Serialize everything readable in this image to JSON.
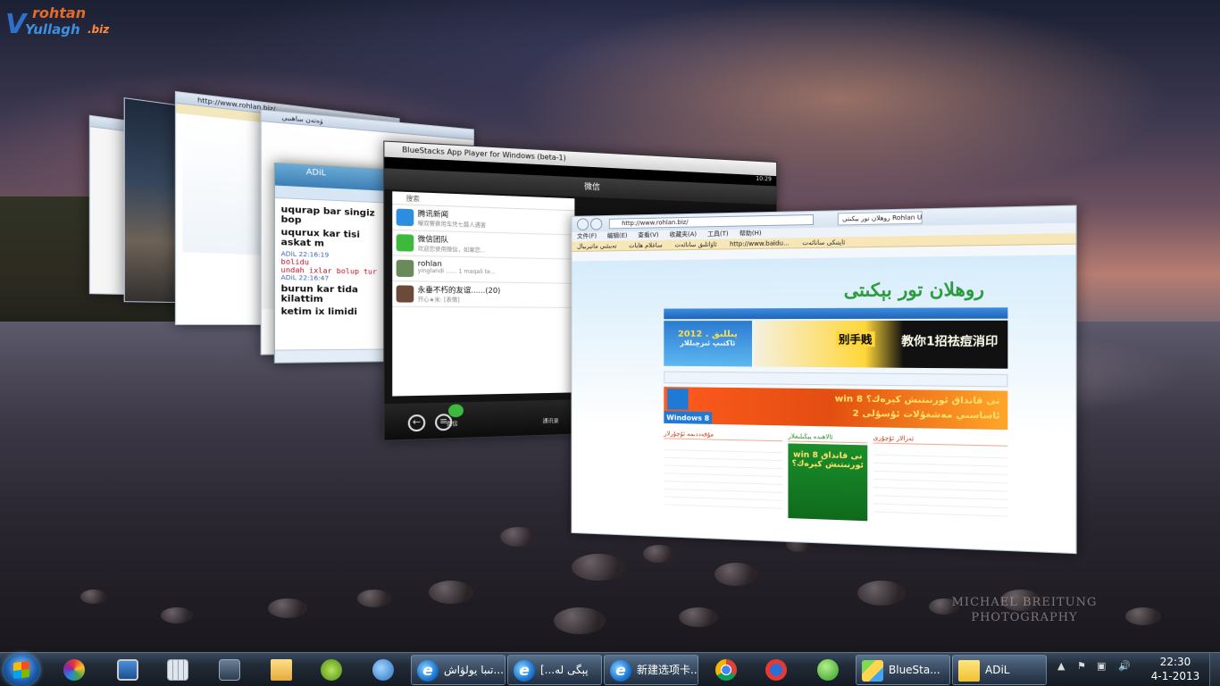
{
  "logo": {
    "top": "rohtan",
    "bottom": "Yullagh",
    "tld": ".biz"
  },
  "watermark": {
    "line1": "MICHAEL BREITUNG",
    "line2": "PHOTOGRAPHY"
  },
  "windows": {
    "bluestacks": {
      "title": "BlueStacks App Player for Windows (beta-1)",
      "time": "10:29",
      "app_title": "微信",
      "search_placeholder": "搜索",
      "chats": [
        {
          "name": "腾讯新闻",
          "snippet": "曝双警察用车凭七聂人遇害",
          "color": "#2d8ee0"
        },
        {
          "name": "微信团队",
          "snippet": "欢迎您使用微信，如果您...",
          "color": "#3dba3d"
        },
        {
          "name": "rohlan",
          "snippet": "yinglandi ...... 1  maqali te...",
          "color": "#6a8a5a"
        },
        {
          "name": "永垂不朽的友谊......(20)",
          "snippet": "开心★米: [表情]",
          "color": "#6c4a3a"
        }
      ],
      "tab_label": "微信",
      "tab2_label": "通讯录"
    },
    "chat": {
      "contact": "ADiL",
      "msg1": "uqurap bar singiz bop",
      "msg2": "uqurux kar tisi askat m",
      "meta1": "ADiL  22:16:19",
      "red1": "bolidu",
      "red2": "undah  ixlar  bolup  tur",
      "meta2": "ADiL  22:16:47",
      "msg3": "burun kar tida kilattim",
      "msg4": "ketim ix limidi"
    },
    "ie_back": {
      "address": "http://www.rohlan.biz/",
      "tab": "ۋەتەن ساھىبى"
    },
    "ie_front": {
      "address": "http://www.rohlan.biz/",
      "tab": "روھلان تور بېكىتى Rohlan Uyg...",
      "menu": [
        "文件(F)",
        "编辑(E)",
        "查看(V)",
        "收藏夹(A)",
        "工具(T)",
        "帮助(H)"
      ],
      "favorites": [
        "ئاۋاتلىق سانائەت",
        "ساغلام ھايات",
        "تەبىئىي ماتېرىيال",
        "http://www.baidu...",
        "ئاپتىكى سانائەت"
      ],
      "site_name": "روھلان تور بېكىتى",
      "ad1_line1": "2012 . يىللىق",
      "ad1_line2": "ئاكتىپ ئىزچىللار",
      "ad2_text1": "别手贱",
      "ad2_text2": "教你1招祛痘消印",
      "banner_line1": "win 8 نى قانداق ئورنىتىش كېرەك؟",
      "banner_line2": "2 ئاساسىي مەشغۇلات ئۇسۇلى",
      "win8_label": "Windows 8",
      "section_left": "مۇقەددىمە ئۇچۇرلار",
      "section_mid": "ئالاھىدە يېڭىلىقلار",
      "section_right": "ئەزالار ئۇچۇرى"
    }
  },
  "taskbar": {
    "pinned": [
      "start",
      "picasa",
      "remote-desktop",
      "calculator",
      "virtual-pc",
      "file-explorer"
    ],
    "buttons": [
      {
        "label": "تىبا يولۋاش...",
        "icon": "ie"
      },
      {
        "label": "[...پېگى لە",
        "icon": "ie"
      },
      {
        "label": "新建选项卡...",
        "icon": "ie"
      }
    ],
    "apps2": [
      "chrome",
      "media-player",
      "mingli"
    ],
    "bluestacks_label": "BlueSta...",
    "adil_label": "ADiL",
    "clock_time": "22:30",
    "clock_date": "4-1-2013"
  }
}
